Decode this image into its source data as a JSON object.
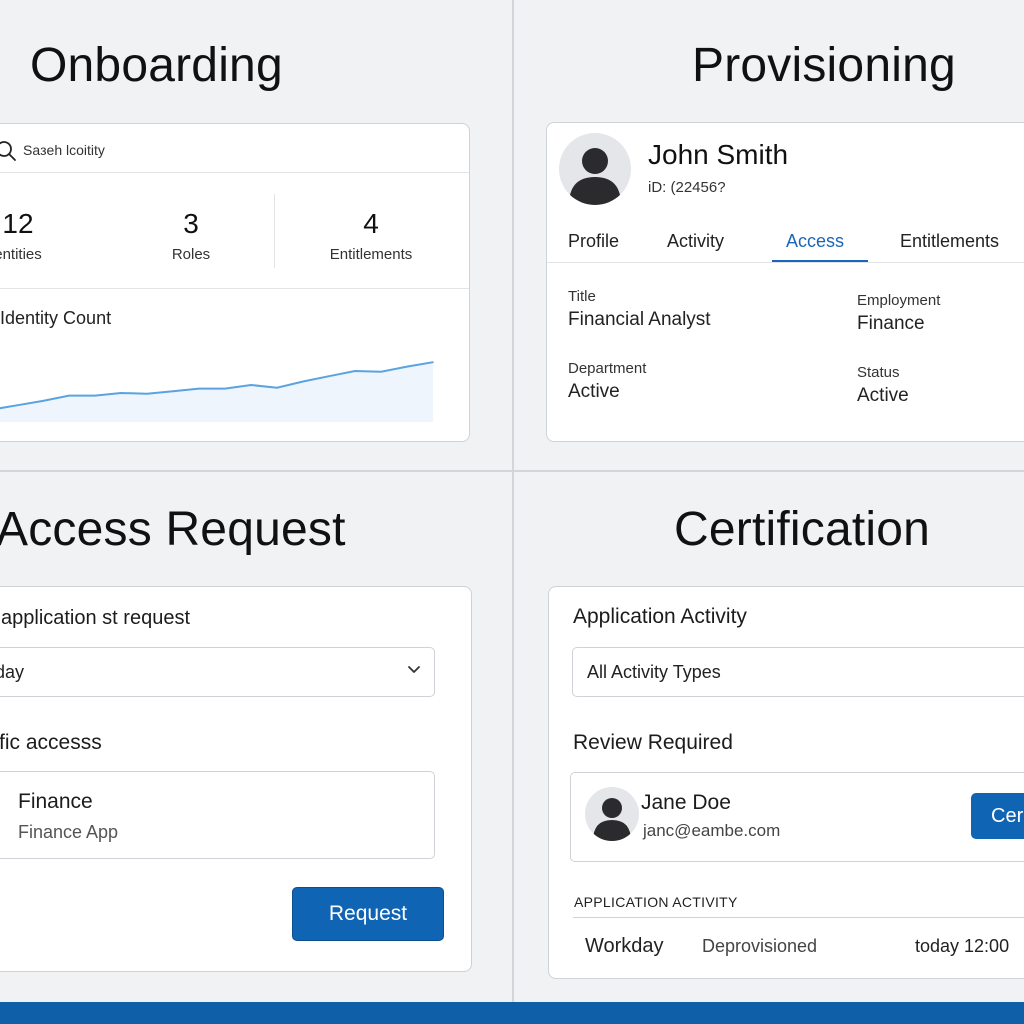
{
  "onboarding": {
    "title": "Onboarding",
    "search_text": "Saзeh lcoitity",
    "stats": [
      {
        "value": "12",
        "label": "entities"
      },
      {
        "value": "3",
        "label": "Roles"
      },
      {
        "value": "4",
        "label": "Entitlements"
      }
    ],
    "chart_title": "e Identity Count"
  },
  "chart_data": {
    "type": "area",
    "title": "e Identity Count",
    "xlabel": "",
    "ylabel": "",
    "x": [
      1,
      2,
      3,
      4,
      5,
      6,
      7,
      8,
      9,
      10,
      11,
      12,
      13,
      14,
      15,
      16,
      17,
      18
    ],
    "series": [
      {
        "values": [
          14,
          19,
          24,
          30,
          30,
          33,
          32,
          35,
          38,
          38,
          42,
          39,
          46,
          52,
          58,
          57,
          63,
          68
        ]
      }
    ],
    "ylim": [
      0,
      100
    ],
    "grid": false,
    "color": "#5aa3e0"
  },
  "provisioning": {
    "title": "Provisioning",
    "name": "John Smith",
    "id_text": "iD: (22456?",
    "tabs": [
      "Profile",
      "Activity",
      "Access",
      "Entitlements"
    ],
    "active_tab": "Access",
    "fields": {
      "title": {
        "label": "Title",
        "value": "Financial Analyst"
      },
      "employment": {
        "label": "Employment",
        "value": "Finance"
      },
      "department": {
        "label": "Department",
        "value": "Active"
      },
      "status": {
        "label": "Status",
        "value": "Active"
      }
    }
  },
  "access_request": {
    "title": "Access Request",
    "select_label": "application st request",
    "select_value": "sday",
    "access_label": "fic accesss",
    "option": {
      "name": "Finance",
      "sub": "Finance App"
    },
    "request_button": "Request"
  },
  "certification": {
    "title": "Certification",
    "section_title": "Application Activity",
    "filter_value": "All Activity Types",
    "review_label": "Review Required",
    "reviewer": {
      "name": "Jane Doe",
      "email": "janc@eambe.com"
    },
    "certify_button": "Cer",
    "activity_caption": "APPLICATION ACTIVITY",
    "activity_row": {
      "app": "Workday",
      "action": "Deprovisioned",
      "time": "today 12:00"
    }
  },
  "colors": {
    "accent": "#1a66b8",
    "button": "#0f64b4",
    "bottom_bar": "#0f5ea8"
  }
}
